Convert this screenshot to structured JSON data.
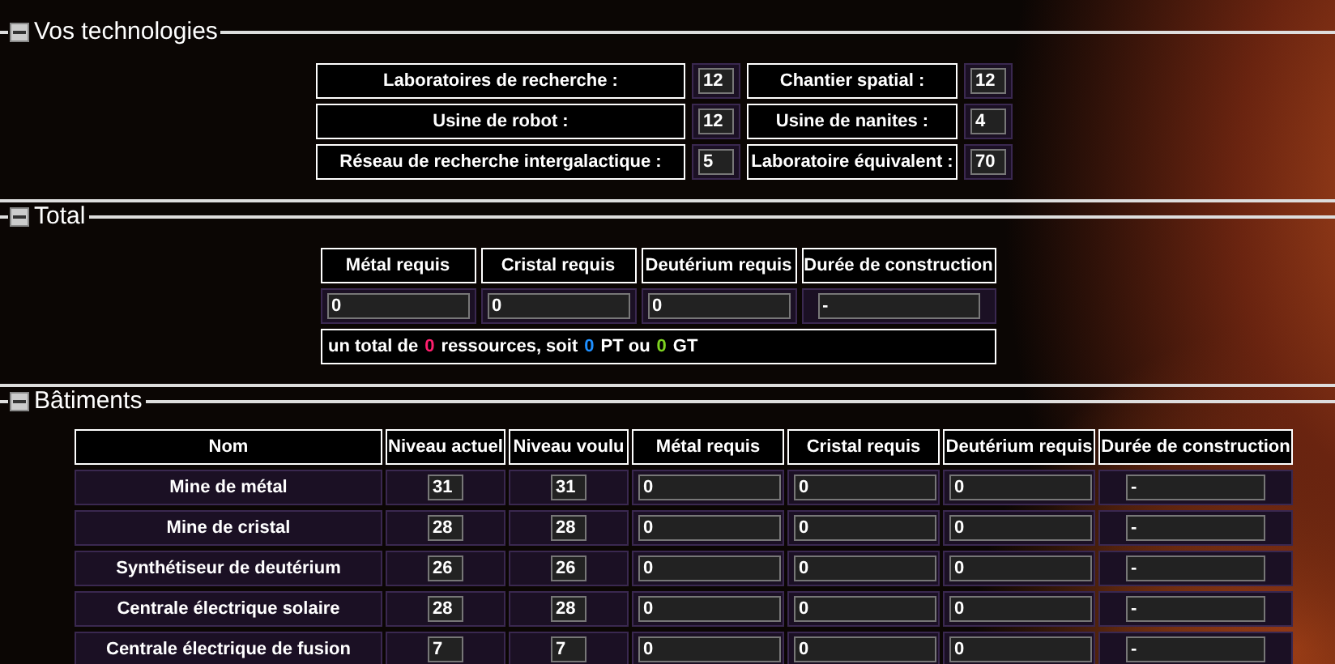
{
  "sections": [
    {
      "title": "Vos technologies",
      "expanded": true
    },
    {
      "title": "Total",
      "expanded": true
    },
    {
      "title": "Bâtiments",
      "expanded": true
    }
  ],
  "technologies": [
    {
      "label": "Laboratoires de recherche :",
      "value": "12"
    },
    {
      "label": "Chantier spatial :",
      "value": "12"
    },
    {
      "label": "Usine de robot :",
      "value": "12"
    },
    {
      "label": "Usine de nanites :",
      "value": "4"
    },
    {
      "label": "Réseau de recherche intergalactique :",
      "value": "5"
    },
    {
      "label": "Laboratoire équivalent :",
      "value": "70"
    }
  ],
  "total": {
    "columns": [
      "Métal requis",
      "Cristal requis",
      "Deutérium requis",
      "Durée de construction"
    ],
    "values": [
      "0",
      "0",
      "0",
      "-"
    ],
    "summary": [
      {
        "text": "un total de"
      },
      {
        "text": "0",
        "color": "#ff1f6e"
      },
      {
        "text": "ressources, soit"
      },
      {
        "text": "0",
        "color": "#1e8fff"
      },
      {
        "text": "PT ou"
      },
      {
        "text": "0",
        "color": "#7ed321"
      },
      {
        "text": "GT"
      }
    ]
  },
  "buildings": {
    "columns": [
      "Nom",
      "Niveau actuel",
      "Niveau voulu",
      "Métal requis",
      "Cristal requis",
      "Deutérium requis",
      "Durée de construction"
    ],
    "rows": [
      {
        "name": "Mine de métal",
        "current": "31",
        "wanted": "31",
        "metal": "0",
        "crystal": "0",
        "deuterium": "0",
        "time": "-"
      },
      {
        "name": "Mine de cristal",
        "current": "28",
        "wanted": "28",
        "metal": "0",
        "crystal": "0",
        "deuterium": "0",
        "time": "-"
      },
      {
        "name": "Synthétiseur de deutérium",
        "current": "26",
        "wanted": "26",
        "metal": "0",
        "crystal": "0",
        "deuterium": "0",
        "time": "-"
      },
      {
        "name": "Centrale électrique solaire",
        "current": "28",
        "wanted": "28",
        "metal": "0",
        "crystal": "0",
        "deuterium": "0",
        "time": "-"
      },
      {
        "name": "Centrale électrique de fusion",
        "current": "7",
        "wanted": "7",
        "metal": "0",
        "crystal": "0",
        "deuterium": "0",
        "time": "-"
      }
    ]
  }
}
